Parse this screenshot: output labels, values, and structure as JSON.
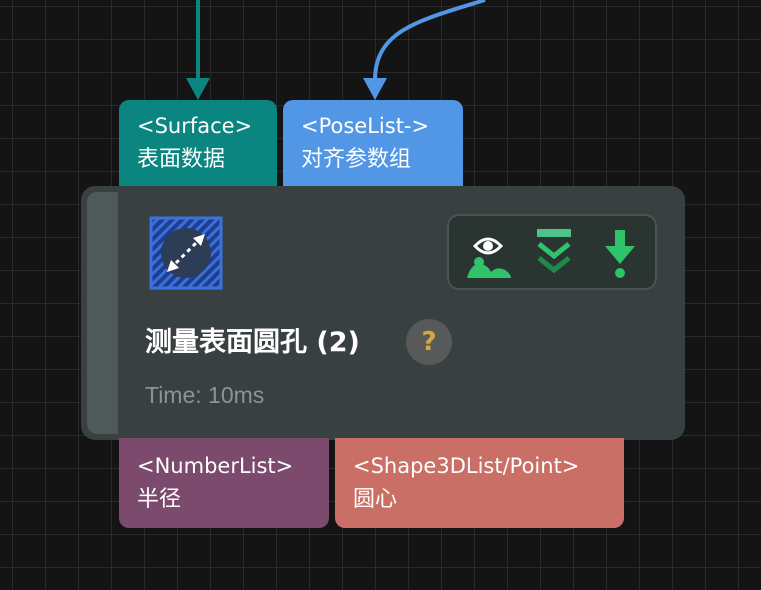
{
  "node": {
    "title": "测量表面圆孔 (2)",
    "help_label": "?",
    "time_text": "Time: 10ms",
    "icon": "resize-diagonal-icon"
  },
  "toolbar": {
    "icons": [
      "eye-person-icon",
      "collapse-chevrons-icon",
      "download-arrow-icon"
    ]
  },
  "inputs": [
    {
      "type": "<Surface>",
      "name": "表面数据",
      "color": "#0a8580"
    },
    {
      "type": "<PoseList->",
      "name": "对齐参数组",
      "color": "#5197e6"
    }
  ],
  "outputs": [
    {
      "type": "<NumberList>",
      "name": "半径",
      "color": "#7b4a6d"
    },
    {
      "type": "<Shape3DList/Point>",
      "name": "圆心",
      "color": "#c96f66"
    }
  ],
  "colors": {
    "canvas": "#141414",
    "node": "#394041",
    "accent_green": "#2fc46a",
    "wire_teal": "#0a8580",
    "wire_blue": "#5197e6"
  }
}
